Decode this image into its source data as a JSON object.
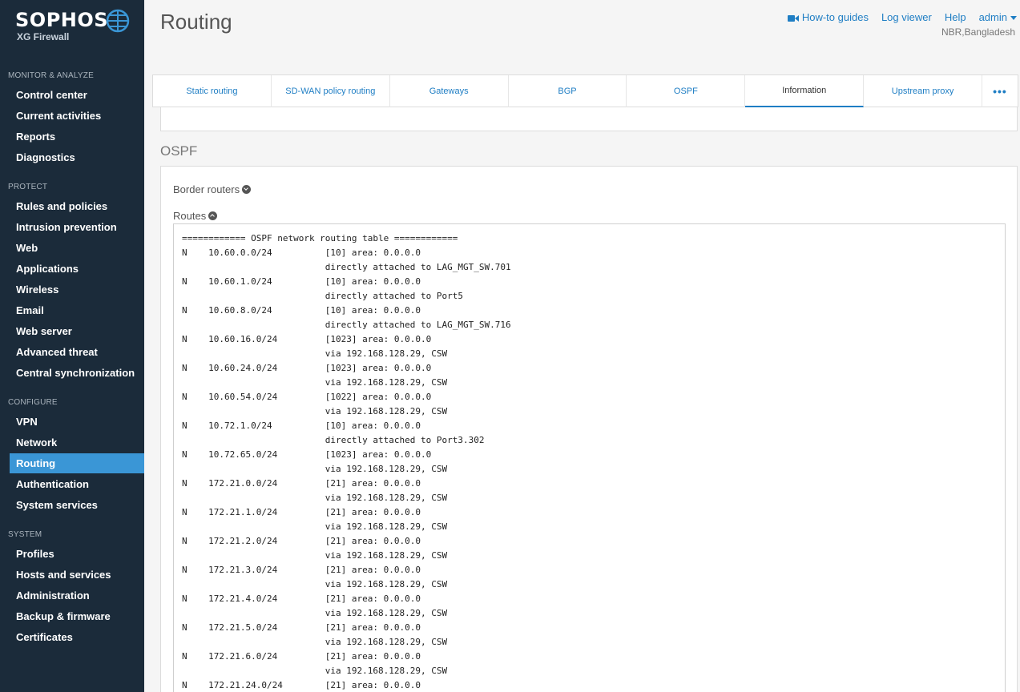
{
  "brand": {
    "name": "SOPHOS",
    "product": "XG Firewall"
  },
  "sidebar": {
    "sections": [
      {
        "title": "MONITOR & ANALYZE",
        "items": [
          "Control center",
          "Current activities",
          "Reports",
          "Diagnostics"
        ]
      },
      {
        "title": "PROTECT",
        "items": [
          "Rules and policies",
          "Intrusion prevention",
          "Web",
          "Applications",
          "Wireless",
          "Email",
          "Web server",
          "Advanced threat",
          "Central synchronization"
        ]
      },
      {
        "title": "CONFIGURE",
        "items": [
          "VPN",
          "Network",
          "Routing",
          "Authentication",
          "System services"
        ]
      },
      {
        "title": "SYSTEM",
        "items": [
          "Profiles",
          "Hosts and services",
          "Administration",
          "Backup & firmware",
          "Certificates"
        ]
      }
    ],
    "active_item": "Routing"
  },
  "header": {
    "title": "Routing",
    "links": {
      "howto": "How-to guides",
      "log_viewer": "Log viewer",
      "help": "Help",
      "user": "admin"
    },
    "subtitle": "NBR,Bangladesh"
  },
  "tabs": {
    "items": [
      "Static routing",
      "SD-WAN policy routing",
      "Gateways",
      "BGP",
      "OSPF",
      "Information",
      "Upstream proxy"
    ],
    "active": "Information",
    "more": "•••"
  },
  "section": {
    "heading": "OSPF",
    "border_routers_label": "Border routers",
    "routes_label": "Routes"
  },
  "routes_output": "============ OSPF network routing table ============\nN    10.60.0.0/24          [10] area: 0.0.0.0\n                           directly attached to LAG_MGT_SW.701\nN    10.60.1.0/24          [10] area: 0.0.0.0\n                           directly attached to Port5\nN    10.60.8.0/24          [10] area: 0.0.0.0\n                           directly attached to LAG_MGT_SW.716\nN    10.60.16.0/24         [1023] area: 0.0.0.0\n                           via 192.168.128.29, CSW\nN    10.60.24.0/24         [1023] area: 0.0.0.0\n                           via 192.168.128.29, CSW\nN    10.60.54.0/24         [1022] area: 0.0.0.0\n                           via 192.168.128.29, CSW\nN    10.72.1.0/24          [10] area: 0.0.0.0\n                           directly attached to Port3.302\nN    10.72.65.0/24         [1023] area: 0.0.0.0\n                           via 192.168.128.29, CSW\nN    172.21.0.0/24         [21] area: 0.0.0.0\n                           via 192.168.128.29, CSW\nN    172.21.1.0/24         [21] area: 0.0.0.0\n                           via 192.168.128.29, CSW\nN    172.21.2.0/24         [21] area: 0.0.0.0\n                           via 192.168.128.29, CSW\nN    172.21.3.0/24         [21] area: 0.0.0.0\n                           via 192.168.128.29, CSW\nN    172.21.4.0/24         [21] area: 0.0.0.0\n                           via 192.168.128.29, CSW\nN    172.21.5.0/24         [21] area: 0.0.0.0\n                           via 192.168.128.29, CSW\nN    172.21.6.0/24         [21] area: 0.0.0.0\n                           via 192.168.128.29, CSW\nN    172.21.24.0/24        [21] area: 0.0.0.0",
  "colors": {
    "sidebar_bg": "#1b2b3a",
    "active_nav": "#3a96d6",
    "link": "#1f7ec4"
  }
}
